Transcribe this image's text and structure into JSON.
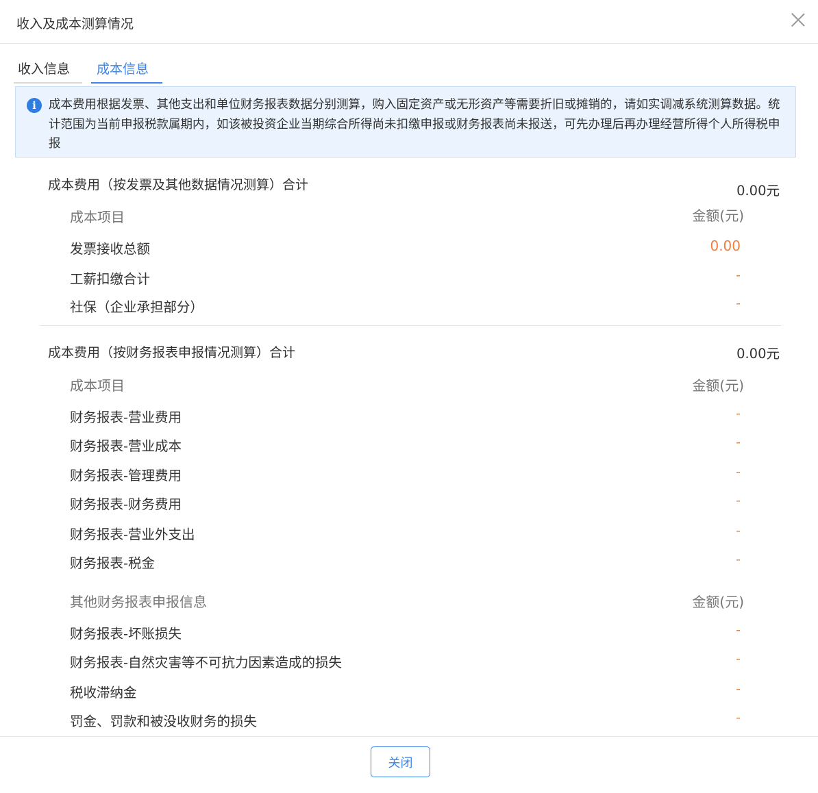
{
  "dialog": {
    "title": "收入及成本测算情况",
    "close_icon": "close-icon",
    "close_button_label": "关闭"
  },
  "tabs": [
    {
      "label": "收入信息",
      "active": false
    },
    {
      "label": "成本信息",
      "active": true
    }
  ],
  "notice": {
    "icon": "info-icon",
    "icon_glyph": "i",
    "text": "成本费用根据发票、其他支出和单位财务报表数据分别测算，购入固定资产或无形资产等需要折旧或摊销的，请如实调减系统测算数据。统计范围为当前申报税款属期内，如该被投资企业当期综合所得尚未扣缴申报或财务报表尚未报送，可先办理后再办理经营所得个人所得税申报"
  },
  "section1": {
    "title": "成本费用（按发票及其他数据情况测算）合计",
    "total": "0.00元",
    "header_label": "成本项目",
    "header_amount": "金额(元)",
    "rows": [
      {
        "label": "发票接收总额",
        "value": "0.00"
      },
      {
        "label": "工薪扣缴合计",
        "value": "-"
      },
      {
        "label": "社保（企业承担部分）",
        "value": "-"
      }
    ]
  },
  "section2": {
    "title": "成本费用（按财务报表申报情况测算）合计",
    "total": "0.00元",
    "header_label": "成本项目",
    "header_amount": "金额(元)",
    "rows": [
      {
        "label": "财务报表-营业费用",
        "value": "-"
      },
      {
        "label": "财务报表-营业成本",
        "value": "-"
      },
      {
        "label": "财务报表-管理费用",
        "value": "-"
      },
      {
        "label": "财务报表-财务费用",
        "value": "-"
      },
      {
        "label": "财务报表-营业外支出",
        "value": "-"
      },
      {
        "label": "财务报表-税金",
        "value": "-"
      }
    ],
    "other_header_label": "其他财务报表申报信息",
    "other_header_amount": "金额(元)",
    "other_rows": [
      {
        "label": "财务报表-坏账损失",
        "value": "-"
      },
      {
        "label": "财务报表-自然灾害等不可抗力因素造成的损失",
        "value": "-"
      },
      {
        "label": "税收滞纳金",
        "value": "-"
      },
      {
        "label": "罚金、罚款和被没收财务的损失",
        "value": "-"
      }
    ]
  },
  "colors": {
    "accent": "#3d86e8",
    "value_orange": "#f08040",
    "notice_bg": "#ebf4fe"
  }
}
